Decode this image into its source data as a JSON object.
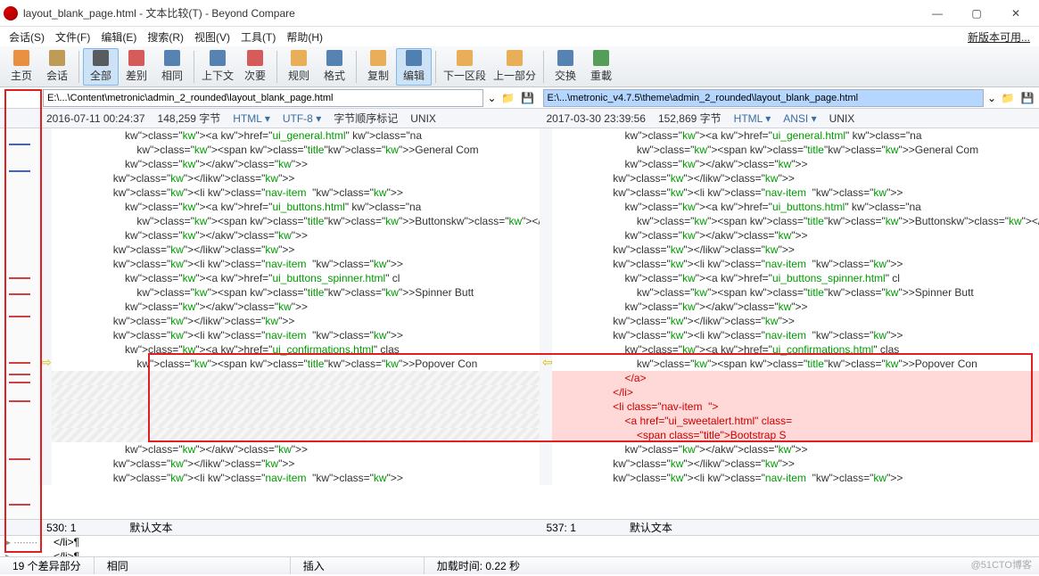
{
  "window": {
    "title": "layout_blank_page.html - 文本比较(T) - Beyond Compare",
    "min": "—",
    "max": "▢",
    "close": "✕"
  },
  "menu": [
    "会话(S)",
    "文件(F)",
    "编辑(E)",
    "搜索(R)",
    "视图(V)",
    "工具(T)",
    "帮助(H)"
  ],
  "newVersion": "新版本可用...",
  "toolbar": [
    {
      "l": "主页",
      "c": "#e67e22"
    },
    {
      "l": "会话",
      "c": "#b58b3a"
    },
    {
      "l": "全部",
      "c": "#444",
      "active": true
    },
    {
      "l": "差别",
      "c": "#d04040"
    },
    {
      "l": "相同",
      "c": "#3a6ea5"
    },
    {
      "l": "上下文",
      "c": "#3a6ea5"
    },
    {
      "l": "次要",
      "c": "#d04040"
    },
    {
      "l": "规则",
      "c": "#e6a23c"
    },
    {
      "l": "格式",
      "c": "#3a6ea5"
    },
    {
      "l": "复制",
      "c": "#e6a23c"
    },
    {
      "l": "编辑",
      "c": "#3a6ea5",
      "active": true
    },
    {
      "l": "下一区段",
      "c": "#e6a23c"
    },
    {
      "l": "上一部分",
      "c": "#e6a23c"
    },
    {
      "l": "交换",
      "c": "#3a6ea5"
    },
    {
      "l": "重載",
      "c": "#388e3c"
    }
  ],
  "left": {
    "path": "E:\\...\\Content\\metronic\\admin_2_rounded\\layout_blank_page.html",
    "date": "2016-07-11 00:24:37",
    "size": "148,259 字节",
    "type": "HTML",
    "enc": "UTF-8",
    "bom": "字节顺序标记",
    "os": "UNIX",
    "pos": "530: 1",
    "defText": "默认文本"
  },
  "right": {
    "path": "E:\\...\\metronic_v4.7.5\\theme\\admin_2_rounded\\layout_blank_page.html",
    "date": "2017-03-30 23:39:56",
    "size": "152,869 字节",
    "type": "HTML",
    "enc": "ANSI",
    "os": "UNIX",
    "pos": "537: 1",
    "defText": "默认文本"
  },
  "code_left": [
    "                        <a href=\"ui_general.html\" class=\"na",
    "                            <span class=\"title\">General Com",
    "                        </a>",
    "                    </li>",
    "                    <li class=\"nav-item  \">",
    "                        <a href=\"ui_buttons.html\" class=\"na",
    "                            <span class=\"title\">Buttons</spa",
    "                        </a>",
    "                    </li>",
    "                    <li class=\"nav-item  \">",
    "                        <a href=\"ui_buttons_spinner.html\" cl",
    "                            <span class=\"title\">Spinner Butt",
    "                        </a>",
    "                    </li>",
    "                    <li class=\"nav-item  \">",
    "                        <a href=\"ui_confirmations.html\" clas"
  ],
  "code_left_last": "                            <span class=\"title\">Popover Con",
  "code_left_tail": [
    "                        </a>",
    "                    </li>",
    "                    <li class=\"nav-item  \">"
  ],
  "code_right_diff": [
    "                        </a>",
    "                    </li>",
    "                    <li class=\"nav-item  \">",
    "                        <a href=\"ui_sweetalert.html\" class=",
    "                            <span class=\"title\">Bootstrap S"
  ],
  "merge": [
    "</li>¶",
    "</li>¶"
  ],
  "status": {
    "diff": "19 个差异部分",
    "same": "相同",
    "ins": "插入",
    "load": "加载时间: 0.22 秒"
  },
  "watermark": "@51CTO博客",
  "thumb_marks": [
    3,
    10,
    38,
    42,
    48,
    60,
    63,
    65,
    70,
    85,
    97
  ]
}
